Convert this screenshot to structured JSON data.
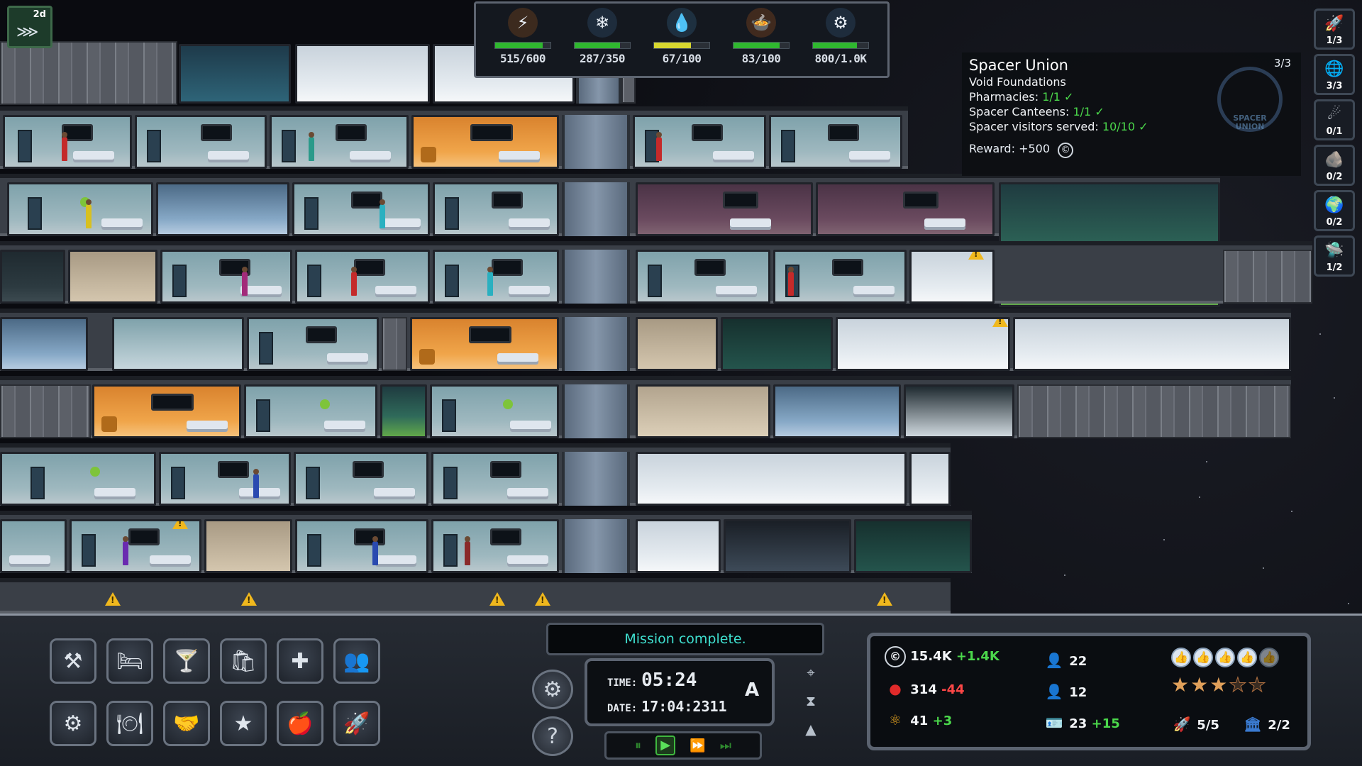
{
  "top_left": {
    "day": "2d"
  },
  "resources": [
    {
      "name": "power",
      "icon": "⚡",
      "value": "515/600",
      "fill": 0.86,
      "color": "#2fb82f",
      "icon_bg": "#3c2a1e"
    },
    {
      "name": "life-support",
      "icon": "❄",
      "value": "287/350",
      "fill": 0.82,
      "color": "#2fb82f",
      "icon_bg": "#1e2c3c"
    },
    {
      "name": "water",
      "icon": "💧",
      "value": "67/100",
      "fill": 0.67,
      "color": "#d8d82f",
      "icon_bg": "#1e3040"
    },
    {
      "name": "food",
      "icon": "🍲",
      "value": "83/100",
      "fill": 0.83,
      "color": "#2fb82f",
      "icon_bg": "#402a1e"
    },
    {
      "name": "crew-capacity",
      "icon": "⚙",
      "value": "800/1.0K",
      "fill": 0.8,
      "color": "#2fb82f",
      "icon_bg": "#1e2c3c"
    }
  ],
  "mission": {
    "title": "Spacer Union",
    "count": "3/3",
    "lines": [
      {
        "label": "Void Foundations",
        "progress": "",
        "check": ""
      },
      {
        "label": "Pharmacies:",
        "progress": "1/1",
        "check": "✓"
      },
      {
        "label": "Spacer Canteens:",
        "progress": "1/1",
        "check": "✓"
      },
      {
        "label": "Spacer visitors served:",
        "progress": "10/10",
        "check": "✓"
      }
    ],
    "reward": "Reward: +500",
    "reward_icon": "©",
    "logo_text": "SPACER UNION"
  },
  "side_missions": [
    {
      "icon": "🚀",
      "count": "1/3"
    },
    {
      "icon": "🌐",
      "count": "3/3"
    },
    {
      "icon": "☄",
      "count": "0/1"
    },
    {
      "icon": "🪨",
      "count": "0/2"
    },
    {
      "icon": "🌍",
      "count": "0/2"
    },
    {
      "icon": "🛸",
      "count": "1/2"
    }
  ],
  "build_menu": [
    {
      "name": "build-tools",
      "icon": "⚒"
    },
    {
      "name": "quarters",
      "icon": "🛏"
    },
    {
      "name": "bar",
      "icon": "🍸"
    },
    {
      "name": "shop",
      "icon": "🛍"
    },
    {
      "name": "medical",
      "icon": "✚"
    },
    {
      "name": "crew",
      "icon": "👥"
    },
    {
      "name": "systems",
      "icon": "⚙"
    },
    {
      "name": "dining",
      "icon": "🍽"
    },
    {
      "name": "trade",
      "icon": "🤝"
    },
    {
      "name": "special",
      "icon": "★"
    },
    {
      "name": "food-production",
      "icon": "🍎"
    },
    {
      "name": "docking",
      "icon": "🚀"
    }
  ],
  "status": {
    "message": "Mission complete."
  },
  "clock": {
    "time_label": "TIME:",
    "time": "05:24",
    "date_label": "DATE:",
    "date": "17:04:2311",
    "auto": "A"
  },
  "stats": {
    "credits": "15.4K",
    "credits_delta": "+1.4K",
    "food": "314",
    "food_delta": "-44",
    "research": "41",
    "research_delta": "+3",
    "crew_a": "22",
    "crew_b": "12",
    "visitors": "23",
    "visitors_delta": "+15",
    "ships": "5/5",
    "capacity": "2/2",
    "rating_thumbs": 4.5,
    "rating_stars": 3
  }
}
